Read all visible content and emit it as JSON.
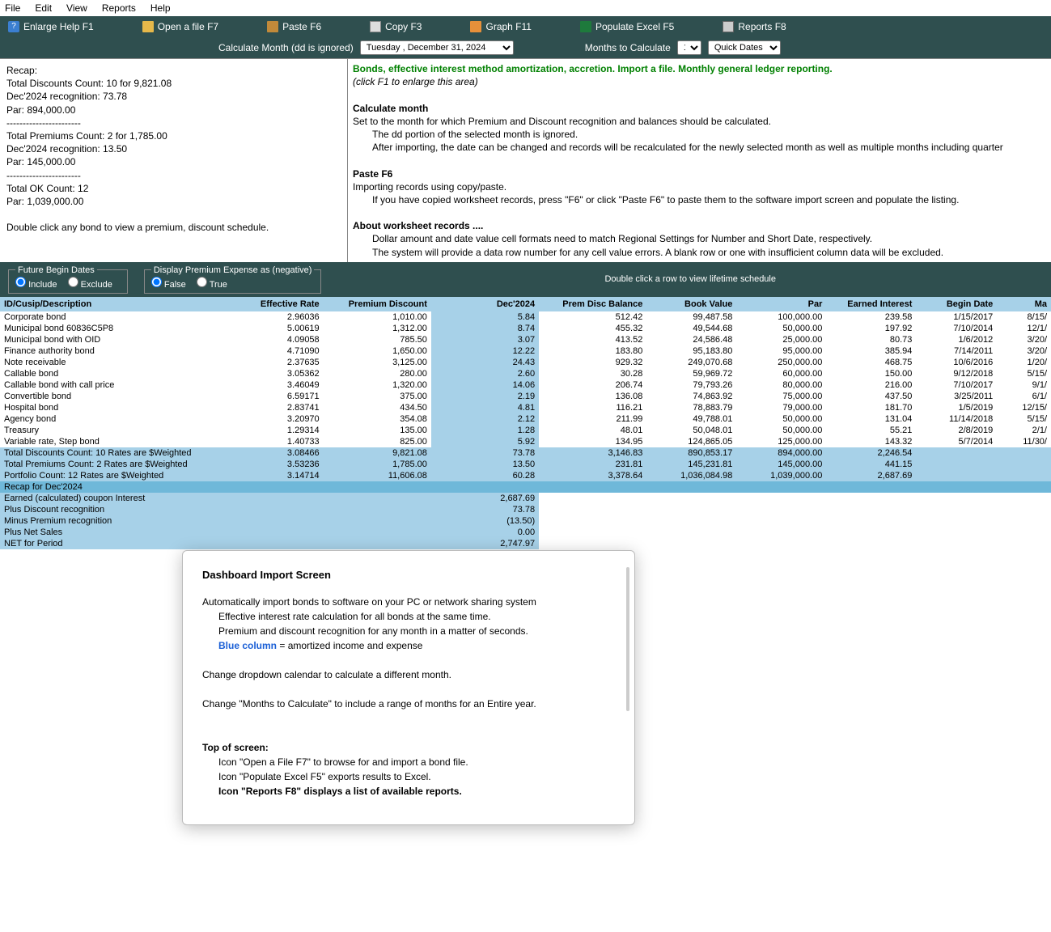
{
  "menu": {
    "file": "File",
    "edit": "Edit",
    "view": "View",
    "reports": "Reports",
    "help": "Help"
  },
  "toolbar": {
    "enlarge": "Enlarge Help  F1",
    "open": "Open a file  F7",
    "paste": "Paste  F6",
    "copy": "Copy  F3",
    "graph": "Graph  F11",
    "excel": "Populate Excel  F5",
    "reports": "Reports  F8"
  },
  "controls": {
    "calc_label": "Calculate Month (dd is ignored)",
    "date_value": "Tuesday  , December 31, 2024",
    "months_label": "Months to Calculate",
    "months_value": "1",
    "quick_value": "Quick Dates"
  },
  "recap": {
    "title": "Recap:",
    "l1": "Total Discounts   Count: 10 for 9,821.08",
    "l2": "Dec'2024 recognition: 73.78",
    "l3": "Par: 894,000.00",
    "sep": "-----------------------",
    "l4": "Total Premiums   Count: 2 for 1,785.00",
    "l5": "Dec'2024 recognition: 13.50",
    "l6": "Par: 145,000.00",
    "l7": "Total OK Count: 12",
    "l8": "Par: 1,039,000.00",
    "l9": "Double click any bond to view a premium, discount schedule."
  },
  "info": {
    "green": "Bonds, effective interest method amortization, accretion.  Import a file.  Monthly general ledger reporting.",
    "italic": "(click F1 to enlarge this area)",
    "h1": "Calculate month",
    "p1": "Set to the month for which Premium and Discount recognition and balances should be calculated.",
    "p1a": "The dd portion of the selected month is ignored.",
    "p1b": "After importing, the date can be changed and records will be recalculated for the newly selected month as well as multiple months including quarter",
    "h2": "Paste  F6",
    "p2": "Importing records using copy/paste.",
    "p2a": "If you have copied worksheet records, press \"F6\" or click \"Paste  F6\" to paste them to the software import screen and populate the listing.",
    "h3": "About worksheet records ....",
    "p3": "Dollar amount and date value cell formats need to match Regional Settings for Number and Short Date, respectively.",
    "p3a": "The system will provide a data row number for any cell value errors.  A blank row or one with insufficient column data will be excluded."
  },
  "options": {
    "g1_title": "Future Begin Dates",
    "g1_include": "Include",
    "g1_exclude": "Exclude",
    "g2_title": "Display Premium Expense as (negative)",
    "g2_false": "False",
    "g2_true": "True",
    "hint": "Double click a row to view lifetime schedule"
  },
  "headers": {
    "c0": "ID/Cusip/Description",
    "c1": "Effective Rate",
    "c2": "Premium Discount",
    "c3": "Dec'2024",
    "c4": "Prem Disc Balance",
    "c5": "Book Value",
    "c6": "Par",
    "c7": "Earned Interest",
    "c8": "Begin Date",
    "c9": "Ma"
  },
  "rows": [
    {
      "c0": "Corporate bond",
      "c1": "2.96036",
      "c2": "1,010.00",
      "c3": "5.84",
      "c4": "512.42",
      "c5": "99,487.58",
      "c6": "100,000.00",
      "c7": "239.58",
      "c8": "1/15/2017",
      "c9": "8/15/"
    },
    {
      "c0": "Municipal bond  60836C5P8",
      "c1": "5.00619",
      "c2": "1,312.00",
      "c3": "8.74",
      "c4": "455.32",
      "c5": "49,544.68",
      "c6": "50,000.00",
      "c7": "197.92",
      "c8": "7/10/2014",
      "c9": "12/1/"
    },
    {
      "c0": "Municipal bond with OID",
      "c1": "4.09058",
      "c2": "785.50",
      "c3": "3.07",
      "c4": "413.52",
      "c5": "24,586.48",
      "c6": "25,000.00",
      "c7": "80.73",
      "c8": "1/6/2012",
      "c9": "3/20/"
    },
    {
      "c0": "Finance authority bond",
      "c1": "4.71090",
      "c2": "1,650.00",
      "c3": "12.22",
      "c4": "183.80",
      "c5": "95,183.80",
      "c6": "95,000.00",
      "c7": "385.94",
      "c8": "7/14/2011",
      "c9": "3/20/"
    },
    {
      "c0": "Note receivable",
      "c1": "2.37635",
      "c2": "3,125.00",
      "c3": "24.43",
      "c4": "929.32",
      "c5": "249,070.68",
      "c6": "250,000.00",
      "c7": "468.75",
      "c8": "10/6/2016",
      "c9": "1/20/"
    },
    {
      "c0": "Callable bond",
      "c1": "3.05362",
      "c2": "280.00",
      "c3": "2.60",
      "c4": "30.28",
      "c5": "59,969.72",
      "c6": "60,000.00",
      "c7": "150.00",
      "c8": "9/12/2018",
      "c9": "5/15/"
    },
    {
      "c0": "Callable bond with call price",
      "c1": "3.46049",
      "c2": "1,320.00",
      "c3": "14.06",
      "c4": "206.74",
      "c5": "79,793.26",
      "c6": "80,000.00",
      "c7": "216.00",
      "c8": "7/10/2017",
      "c9": "9/1/"
    },
    {
      "c0": "Convertible bond",
      "c1": "6.59171",
      "c2": "375.00",
      "c3": "2.19",
      "c4": "136.08",
      "c5": "74,863.92",
      "c6": "75,000.00",
      "c7": "437.50",
      "c8": "3/25/2011",
      "c9": "6/1/"
    },
    {
      "c0": "Hospital bond",
      "c1": "2.83741",
      "c2": "434.50",
      "c3": "4.81",
      "c4": "116.21",
      "c5": "78,883.79",
      "c6": "79,000.00",
      "c7": "181.70",
      "c8": "1/5/2019",
      "c9": "12/15/"
    },
    {
      "c0": "Agency bond",
      "c1": "3.20970",
      "c2": "354.08",
      "c3": "2.12",
      "c4": "211.99",
      "c5": "49,788.01",
      "c6": "50,000.00",
      "c7": "131.04",
      "c8": "11/14/2018",
      "c9": "5/15/"
    },
    {
      "c0": "Treasury",
      "c1": "1.29314",
      "c2": "135.00",
      "c3": "1.28",
      "c4": "48.01",
      "c5": "50,048.01",
      "c6": "50,000.00",
      "c7": "55.21",
      "c8": "2/8/2019",
      "c9": "2/1/"
    },
    {
      "c0": "Variable rate, Step bond",
      "c1": "1.40733",
      "c2": "825.00",
      "c3": "5.92",
      "c4": "134.95",
      "c5": "124,865.05",
      "c6": "125,000.00",
      "c7": "143.32",
      "c8": "5/7/2014",
      "c9": "11/30/"
    }
  ],
  "totals": [
    {
      "c0": "Total Discounts   Count: 10   Rates are $Weighted",
      "c1": "3.08466",
      "c2": "9,821.08",
      "c3": "73.78",
      "c4": "3,146.83",
      "c5": "890,853.17",
      "c6": "894,000.00",
      "c7": "2,246.54",
      "c8": "",
      "c9": ""
    },
    {
      "c0": "Total Premiums   Count: 2   Rates are $Weighted",
      "c1": "3.53236",
      "c2": "1,785.00",
      "c3": "13.50",
      "c4": "231.81",
      "c5": "145,231.81",
      "c6": "145,000.00",
      "c7": "441.15",
      "c8": "",
      "c9": ""
    },
    {
      "c0": "Portfolio   Count: 12   Rates are $Weighted",
      "c1": "3.14714",
      "c2": "11,606.08",
      "c3": "60.28",
      "c4": "3,378.64",
      "c5": "1,036,084.98",
      "c6": "1,039,000.00",
      "c7": "2,687.69",
      "c8": "",
      "c9": ""
    }
  ],
  "recap_section": {
    "header": "Recap for Dec'2024",
    "rows": [
      {
        "label": "Earned (calculated) coupon Interest",
        "val": "2,687.69"
      },
      {
        "label": "Plus Discount recognition",
        "val": "73.78"
      },
      {
        "label": "Minus Premium recognition",
        "val": "(13.50)"
      },
      {
        "label": "Plus Net Sales",
        "val": "0.00"
      },
      {
        "label": "NET for Period",
        "val": "2,747.97"
      }
    ]
  },
  "popup": {
    "title": "Dashboard Import Screen",
    "p1": "Automatically import bonds to software on your PC or network sharing system",
    "p1a": "Effective interest rate calculation for all bonds at the same time.",
    "p1b": "Premium and discount recognition for any month in a matter of seconds.",
    "blue_label": "Blue column",
    "blue_rest": " = amortized income and expense",
    "p2": "Change dropdown calendar to calculate a different month.",
    "p3": "Change \"Months to Calculate\" to include a range of months for an Entire year.",
    "h2": "Top of screen:",
    "l1": "Icon \"Open a File F7\" to browse for and import a bond file.",
    "l2": "Icon \"Populate Excel F5\" exports results to Excel.",
    "l3": "Icon \"Reports F8\" displays a list of available reports."
  }
}
